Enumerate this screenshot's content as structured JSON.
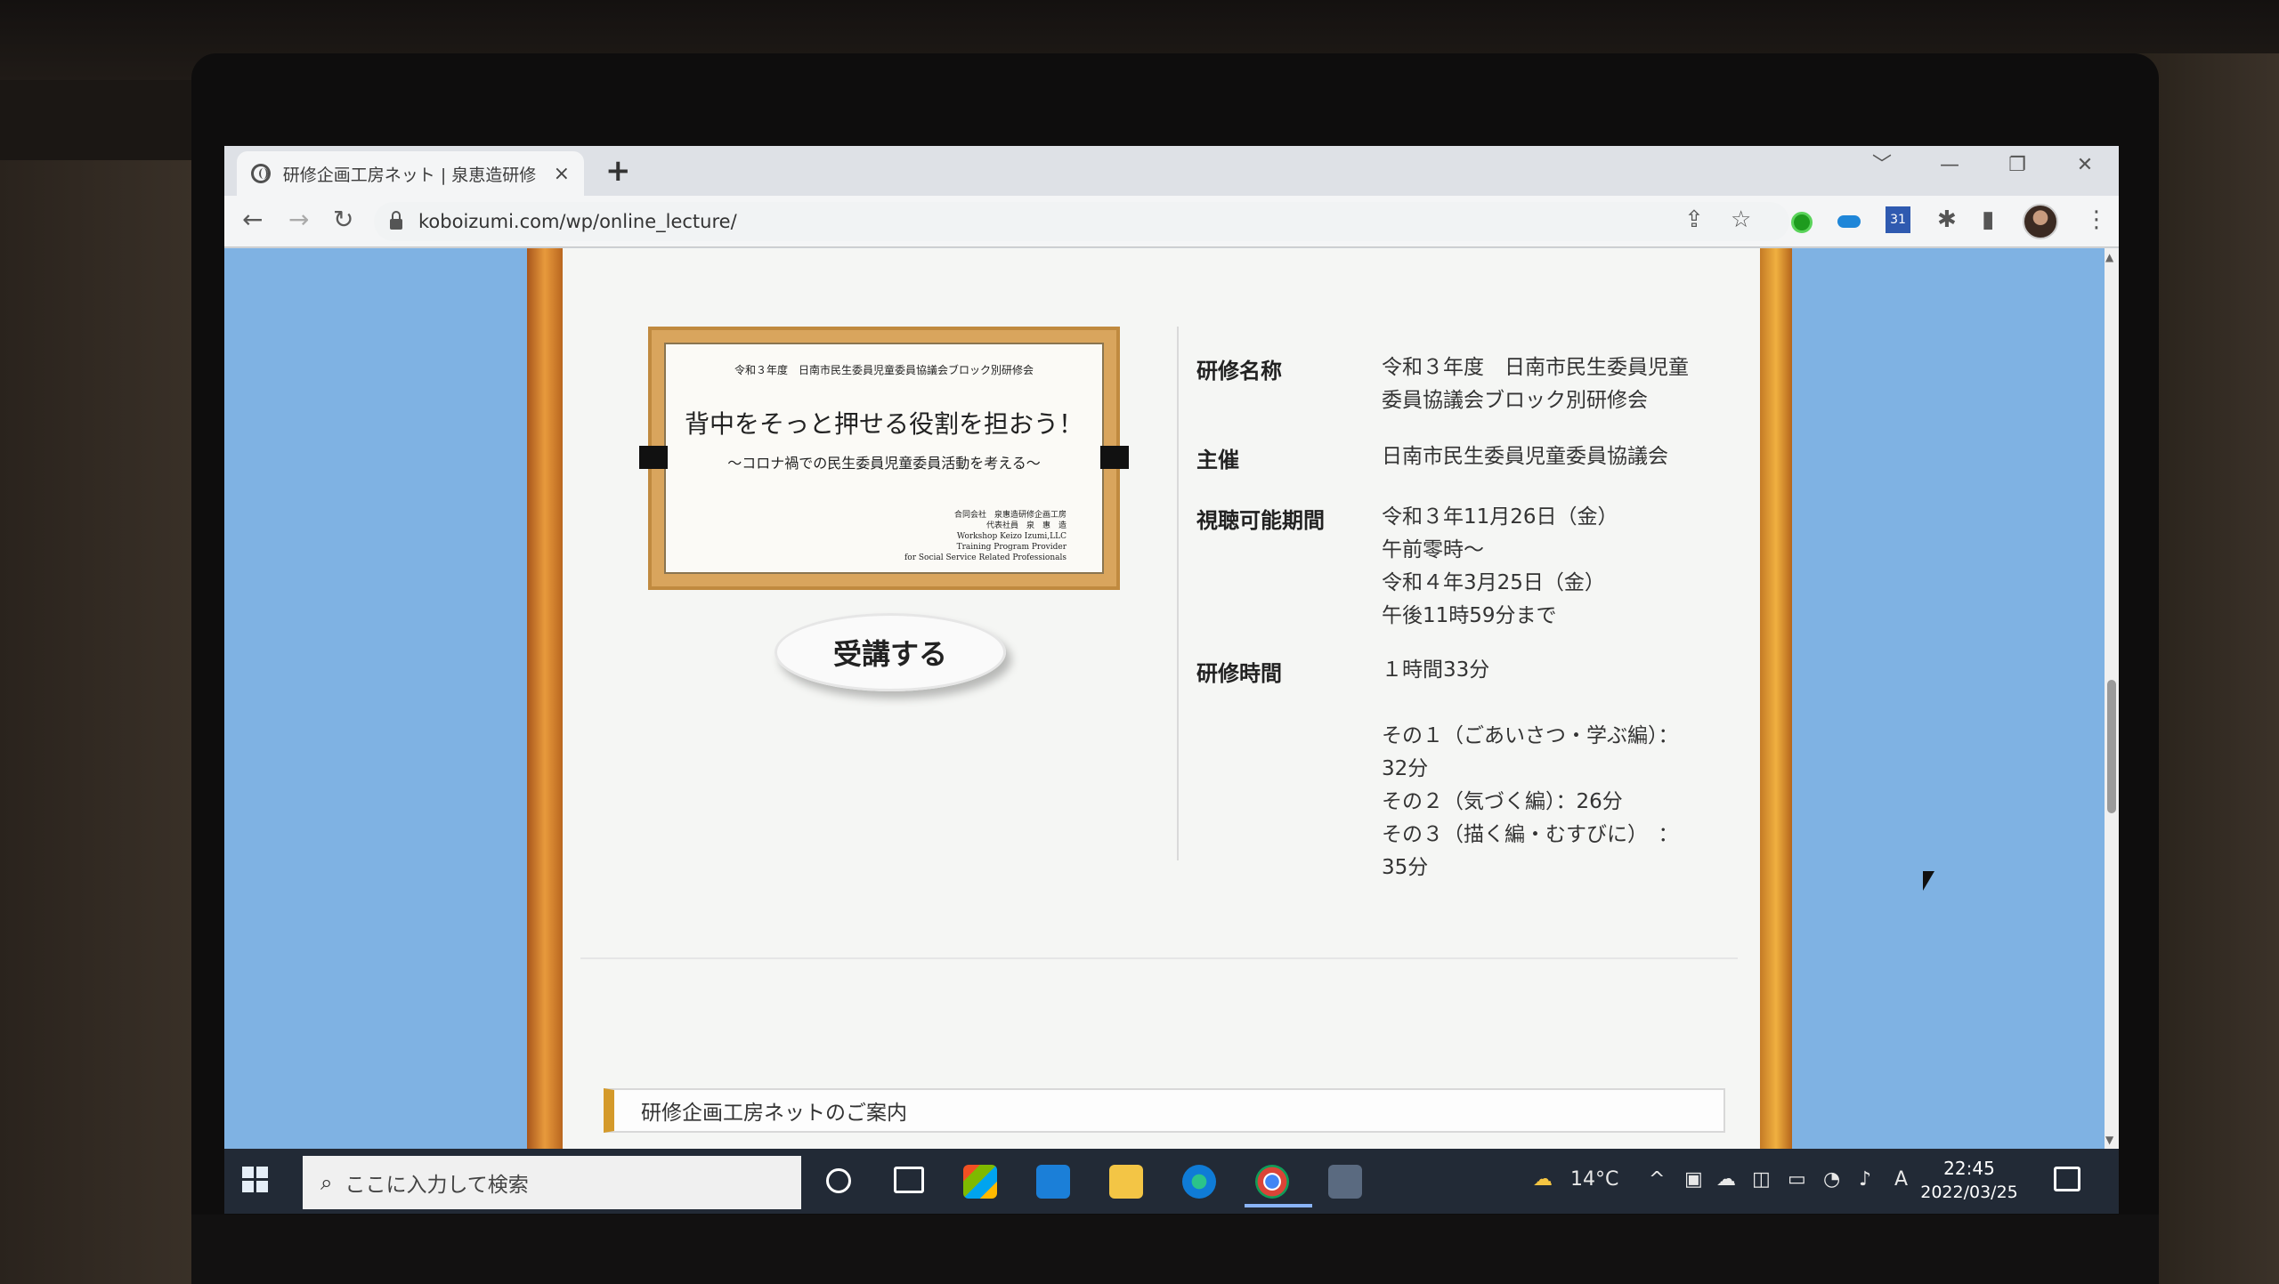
{
  "browser": {
    "tab_title": "研修企画工房ネット | 泉恵造研修",
    "tab_close": "×",
    "new_tab": "+",
    "url": "koboizumi.com/wp/online_lecture/",
    "window_controls": [
      "﹀",
      "—",
      "❐",
      "✕"
    ]
  },
  "poster": {
    "line1": "令和３年度　日南市民生委員児童委員協議会ブロック別研修会",
    "title": "背中をそっと押せる役割を担おう！",
    "subtitle": "～コロナ禍での民生委員児童委員活動を考える～",
    "org": [
      "合同会社　泉惠造研修企画工房",
      "代表社員　泉　惠　造",
      "Workshop Keizo Izumi,LLC",
      "Training Program Provider",
      "for Social Service Related Professionals"
    ]
  },
  "enroll_button": "受講する",
  "info": [
    {
      "label": "研修名称",
      "value": "令和３年度　日南市民生委員児童委員協議会ブロック別研修会"
    },
    {
      "label": "主催",
      "value": "日南市民生委員児童委員協議会"
    },
    {
      "label": "視聴可能期間",
      "lines": [
        "令和３年11月26日（金）",
        "午前零時～",
        "令和４年3月25日（金）",
        "午後11時59分まで"
      ]
    },
    {
      "label": "研修時間",
      "lines": [
        "１時間33分",
        "",
        "その１（ごあいさつ・学ぶ編）：32分",
        "その２（気づく編）：26分",
        "その３（描く編・むすびに）　：35分"
      ]
    }
  ],
  "section_heading": "研修企画工房ネットのご案内",
  "taskbar": {
    "search_placeholder": "ここに入力して検索",
    "temperature": "14°C",
    "ime": "A",
    "time": "22:45",
    "date": "2022/03/25"
  },
  "colors": {
    "page_background": "#7fb2e3",
    "frame_accent": "#d49a2a",
    "taskbar": "#222a36"
  },
  "icons": [
    "globe-icon",
    "back-icon",
    "forward-icon",
    "reload-icon",
    "lock-icon",
    "share-icon",
    "star-icon",
    "extension-icon",
    "sidepanel-icon",
    "menu-icon",
    "windows-start-icon",
    "search-icon",
    "weather-icon",
    "wifi-icon",
    "volume-icon",
    "notification-icon"
  ]
}
